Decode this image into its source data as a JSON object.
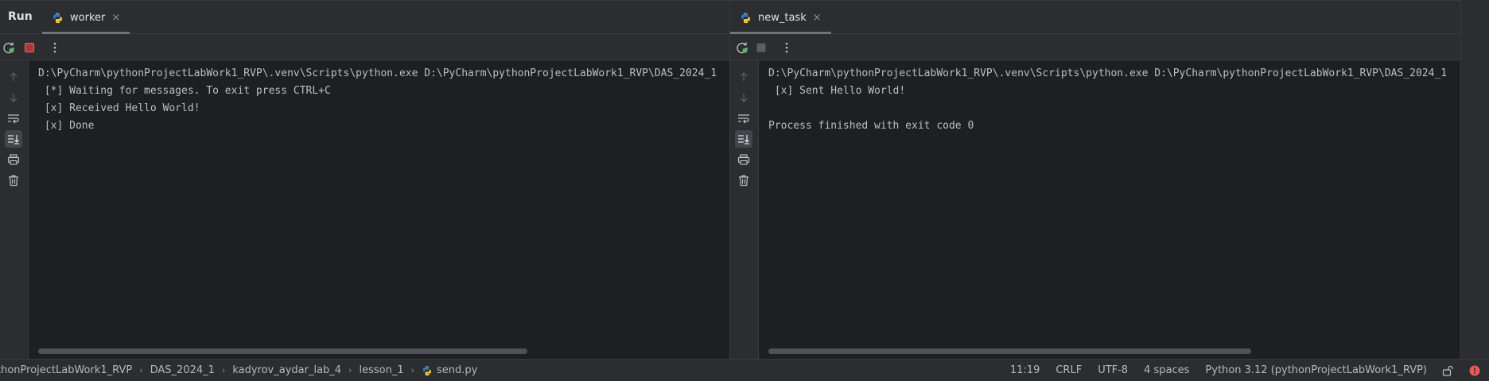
{
  "run_tool_window": {
    "title": "Run"
  },
  "left_panel": {
    "tab": {
      "label": "worker",
      "close": "×"
    },
    "console_lines": [
      "D:\\PyCharm\\pythonProjectLabWork1_RVP\\.venv\\Scripts\\python.exe D:\\PyCharm\\pythonProjectLabWork1_RVP\\DAS_2024_1",
      " [*] Waiting for messages. To exit press CTRL+C",
      " [x] Received Hello World!",
      " [x] Done"
    ]
  },
  "right_panel": {
    "tab": {
      "label": "new_task",
      "close": "×"
    },
    "console_lines": [
      "D:\\PyCharm\\pythonProjectLabWork1_RVP\\.venv\\Scripts\\python.exe D:\\PyCharm\\pythonProjectLabWork1_RVP\\DAS_2024_1",
      " [x] Sent Hello World!",
      "",
      "Process finished with exit code 0"
    ]
  },
  "status_bar": {
    "breadcrumbs": [
      "thonProjectLabWork1_RVP",
      "DAS_2024_1",
      "kadyrov_aydar_lab_4",
      "lesson_1",
      "send.py"
    ],
    "crumb_separator": "›",
    "cursor_position": "11:19",
    "line_separator": "CRLF",
    "encoding": "UTF-8",
    "indent": "4 spaces",
    "interpreter": "Python 3.12 (pythonProjectLabWork1_RVP)"
  },
  "icons": {
    "rerun": "rerun-icon",
    "stop": "stop-icon",
    "more": "kebab-menu-icon",
    "up": "arrow-up-icon",
    "down": "arrow-down-icon",
    "soft_wrap": "soft-wrap-icon",
    "scroll_to_end": "scroll-to-end-icon",
    "print": "printer-icon",
    "clear": "trash-icon",
    "python": "python-file-icon",
    "lock": "unlock-icon",
    "error": "error-indicator-icon"
  },
  "colors": {
    "stop_active": "#db5c5c",
    "stop_inactive": "#6f737a",
    "rerun": "#5fb865",
    "python_blue": "#3d7ab8",
    "python_yellow": "#f5c93c",
    "error": "#e55b5b"
  }
}
